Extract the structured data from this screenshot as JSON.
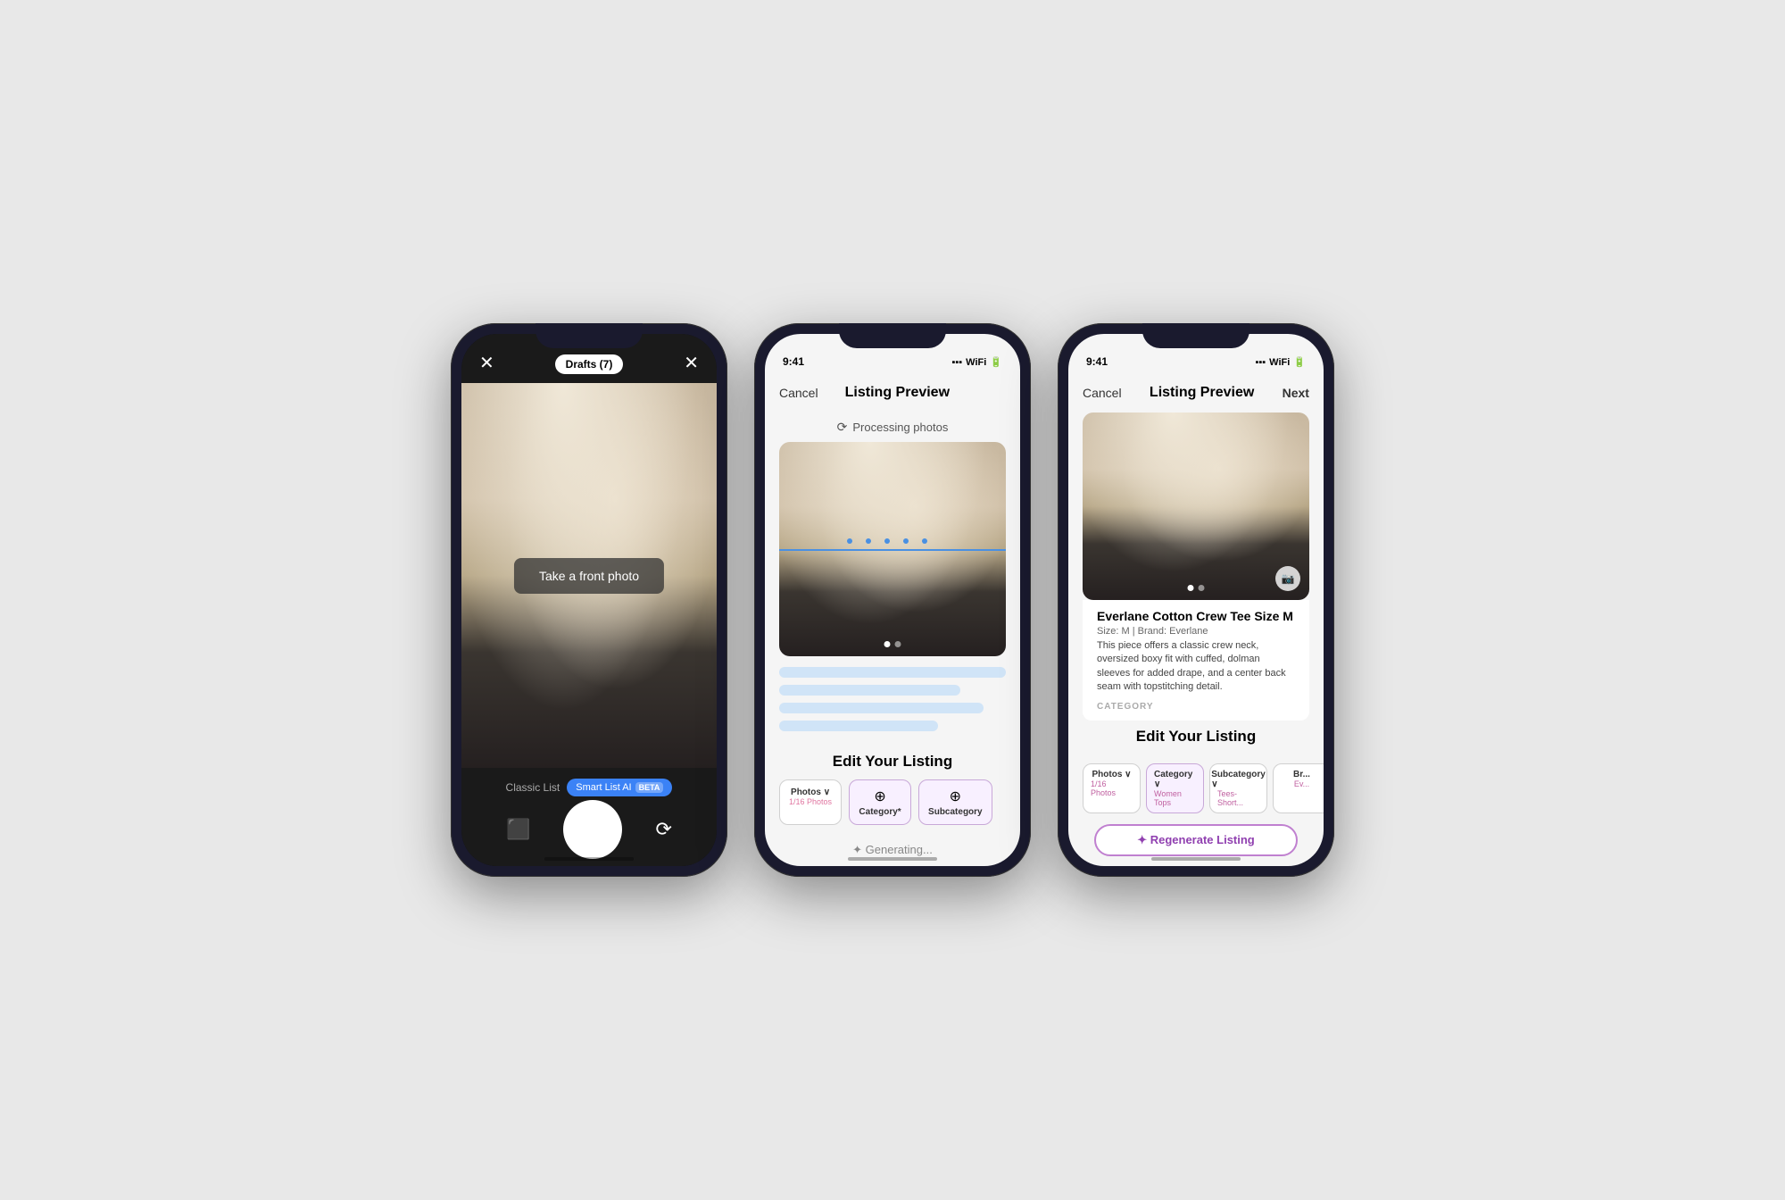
{
  "phones": [
    {
      "id": "camera",
      "status_time": "",
      "top_left": "✕",
      "top_center": "Drafts (7)",
      "top_right": "✕",
      "camera_overlay_text": "Take a front photo",
      "mode_classic": "Classic List",
      "mode_smart": "Smart List AI",
      "mode_beta": "BETA",
      "image_dots": [
        "active",
        "inactive"
      ]
    },
    {
      "id": "processing",
      "status_time": "9:41",
      "status_signal": "●●●",
      "status_wifi": "wifi",
      "status_battery": "battery",
      "nav_cancel": "Cancel",
      "nav_title": "Listing Preview",
      "processing_text": "Processing photos",
      "edit_title": "Edit Your Listing",
      "tabs": [
        {
          "label": "Photos ∨",
          "sublabel": "1/16 Photos",
          "active": false
        },
        {
          "label": "Category*",
          "sublabel": "",
          "icon": "⊕",
          "active": true
        },
        {
          "label": "Subcategory",
          "sublabel": "",
          "icon": "⊕",
          "active": true
        }
      ],
      "generating_text": "✦ Generating..."
    },
    {
      "id": "listing",
      "status_time": "9:41",
      "nav_cancel": "Cancel",
      "nav_title": "Listing Preview",
      "nav_next": "Next",
      "listing_title": "Everlane Cotton Crew Tee Size M",
      "listing_meta": "Size: M  |  Brand: Everlane",
      "listing_desc": "This piece offers a classic crew neck, oversized boxy fit with cuffed, dolman sleeves for added drape, and a center back seam with topstitching detail.",
      "category_label": "CATEGORY",
      "edit_title": "Edit Your Listing",
      "tabs": [
        {
          "label": "Photos ∨",
          "sublabel": "1/16 Photos",
          "active": false
        },
        {
          "label": "Category ∨",
          "sublabel": "Women Tops",
          "active": true
        },
        {
          "label": "Subcategory ∨",
          "sublabel": "Tees- Short...",
          "active": false
        },
        {
          "label": "Br...",
          "sublabel": "Ev...",
          "active": false
        }
      ],
      "regenerate_label": "✦ Regenerate Listing"
    }
  ]
}
